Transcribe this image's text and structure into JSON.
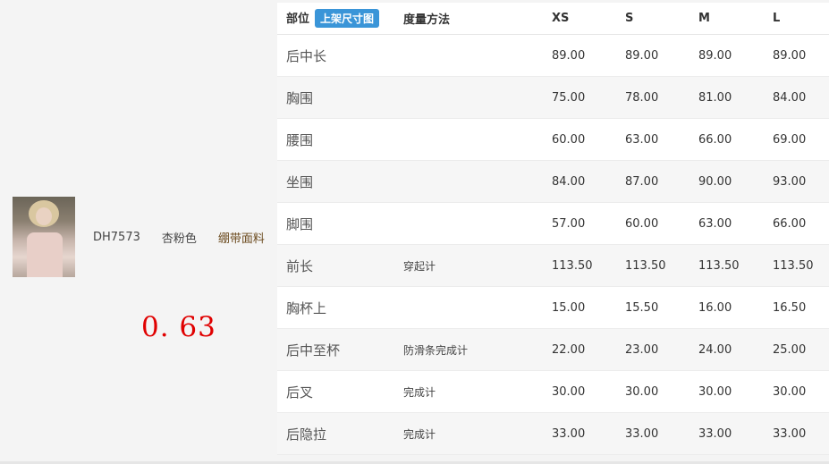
{
  "product": {
    "sku": "DH7573",
    "color": "杏粉色",
    "fabric": "绷带面料",
    "image_icon": "product-photo"
  },
  "ratio": "0. 63",
  "table": {
    "header": {
      "part": "部位",
      "badge": "上架尺寸图",
      "method": "度量方法",
      "sizes": [
        "XS",
        "S",
        "M",
        "L"
      ]
    },
    "rows": [
      {
        "part": "后中长",
        "method": "",
        "values": [
          "89.00",
          "89.00",
          "89.00",
          "89.00"
        ]
      },
      {
        "part": "胸围",
        "method": "",
        "values": [
          "75.00",
          "78.00",
          "81.00",
          "84.00"
        ]
      },
      {
        "part": "腰围",
        "method": "",
        "values": [
          "60.00",
          "63.00",
          "66.00",
          "69.00"
        ]
      },
      {
        "part": "坐围",
        "method": "",
        "values": [
          "84.00",
          "87.00",
          "90.00",
          "93.00"
        ]
      },
      {
        "part": "脚围",
        "method": "",
        "values": [
          "57.00",
          "60.00",
          "63.00",
          "66.00"
        ]
      },
      {
        "part": "前长",
        "method": "穿起计",
        "values": [
          "113.50",
          "113.50",
          "113.50",
          "113.50"
        ]
      },
      {
        "part": "胸杯上",
        "method": "",
        "values": [
          "15.00",
          "15.50",
          "16.00",
          "16.50"
        ]
      },
      {
        "part": "后中至杯",
        "method": "防滑条完成计",
        "values": [
          "22.00",
          "23.00",
          "24.00",
          "25.00"
        ]
      },
      {
        "part": "后叉",
        "method": "完成计",
        "values": [
          "30.00",
          "30.00",
          "30.00",
          "30.00"
        ]
      },
      {
        "part": "后隐拉",
        "method": "完成计",
        "values": [
          "33.00",
          "33.00",
          "33.00",
          "33.00"
        ]
      }
    ]
  },
  "colors": {
    "badge_bg": "#3a95d8",
    "ratio_text": "#e00000",
    "stripe_row": "#f6f6f6"
  }
}
